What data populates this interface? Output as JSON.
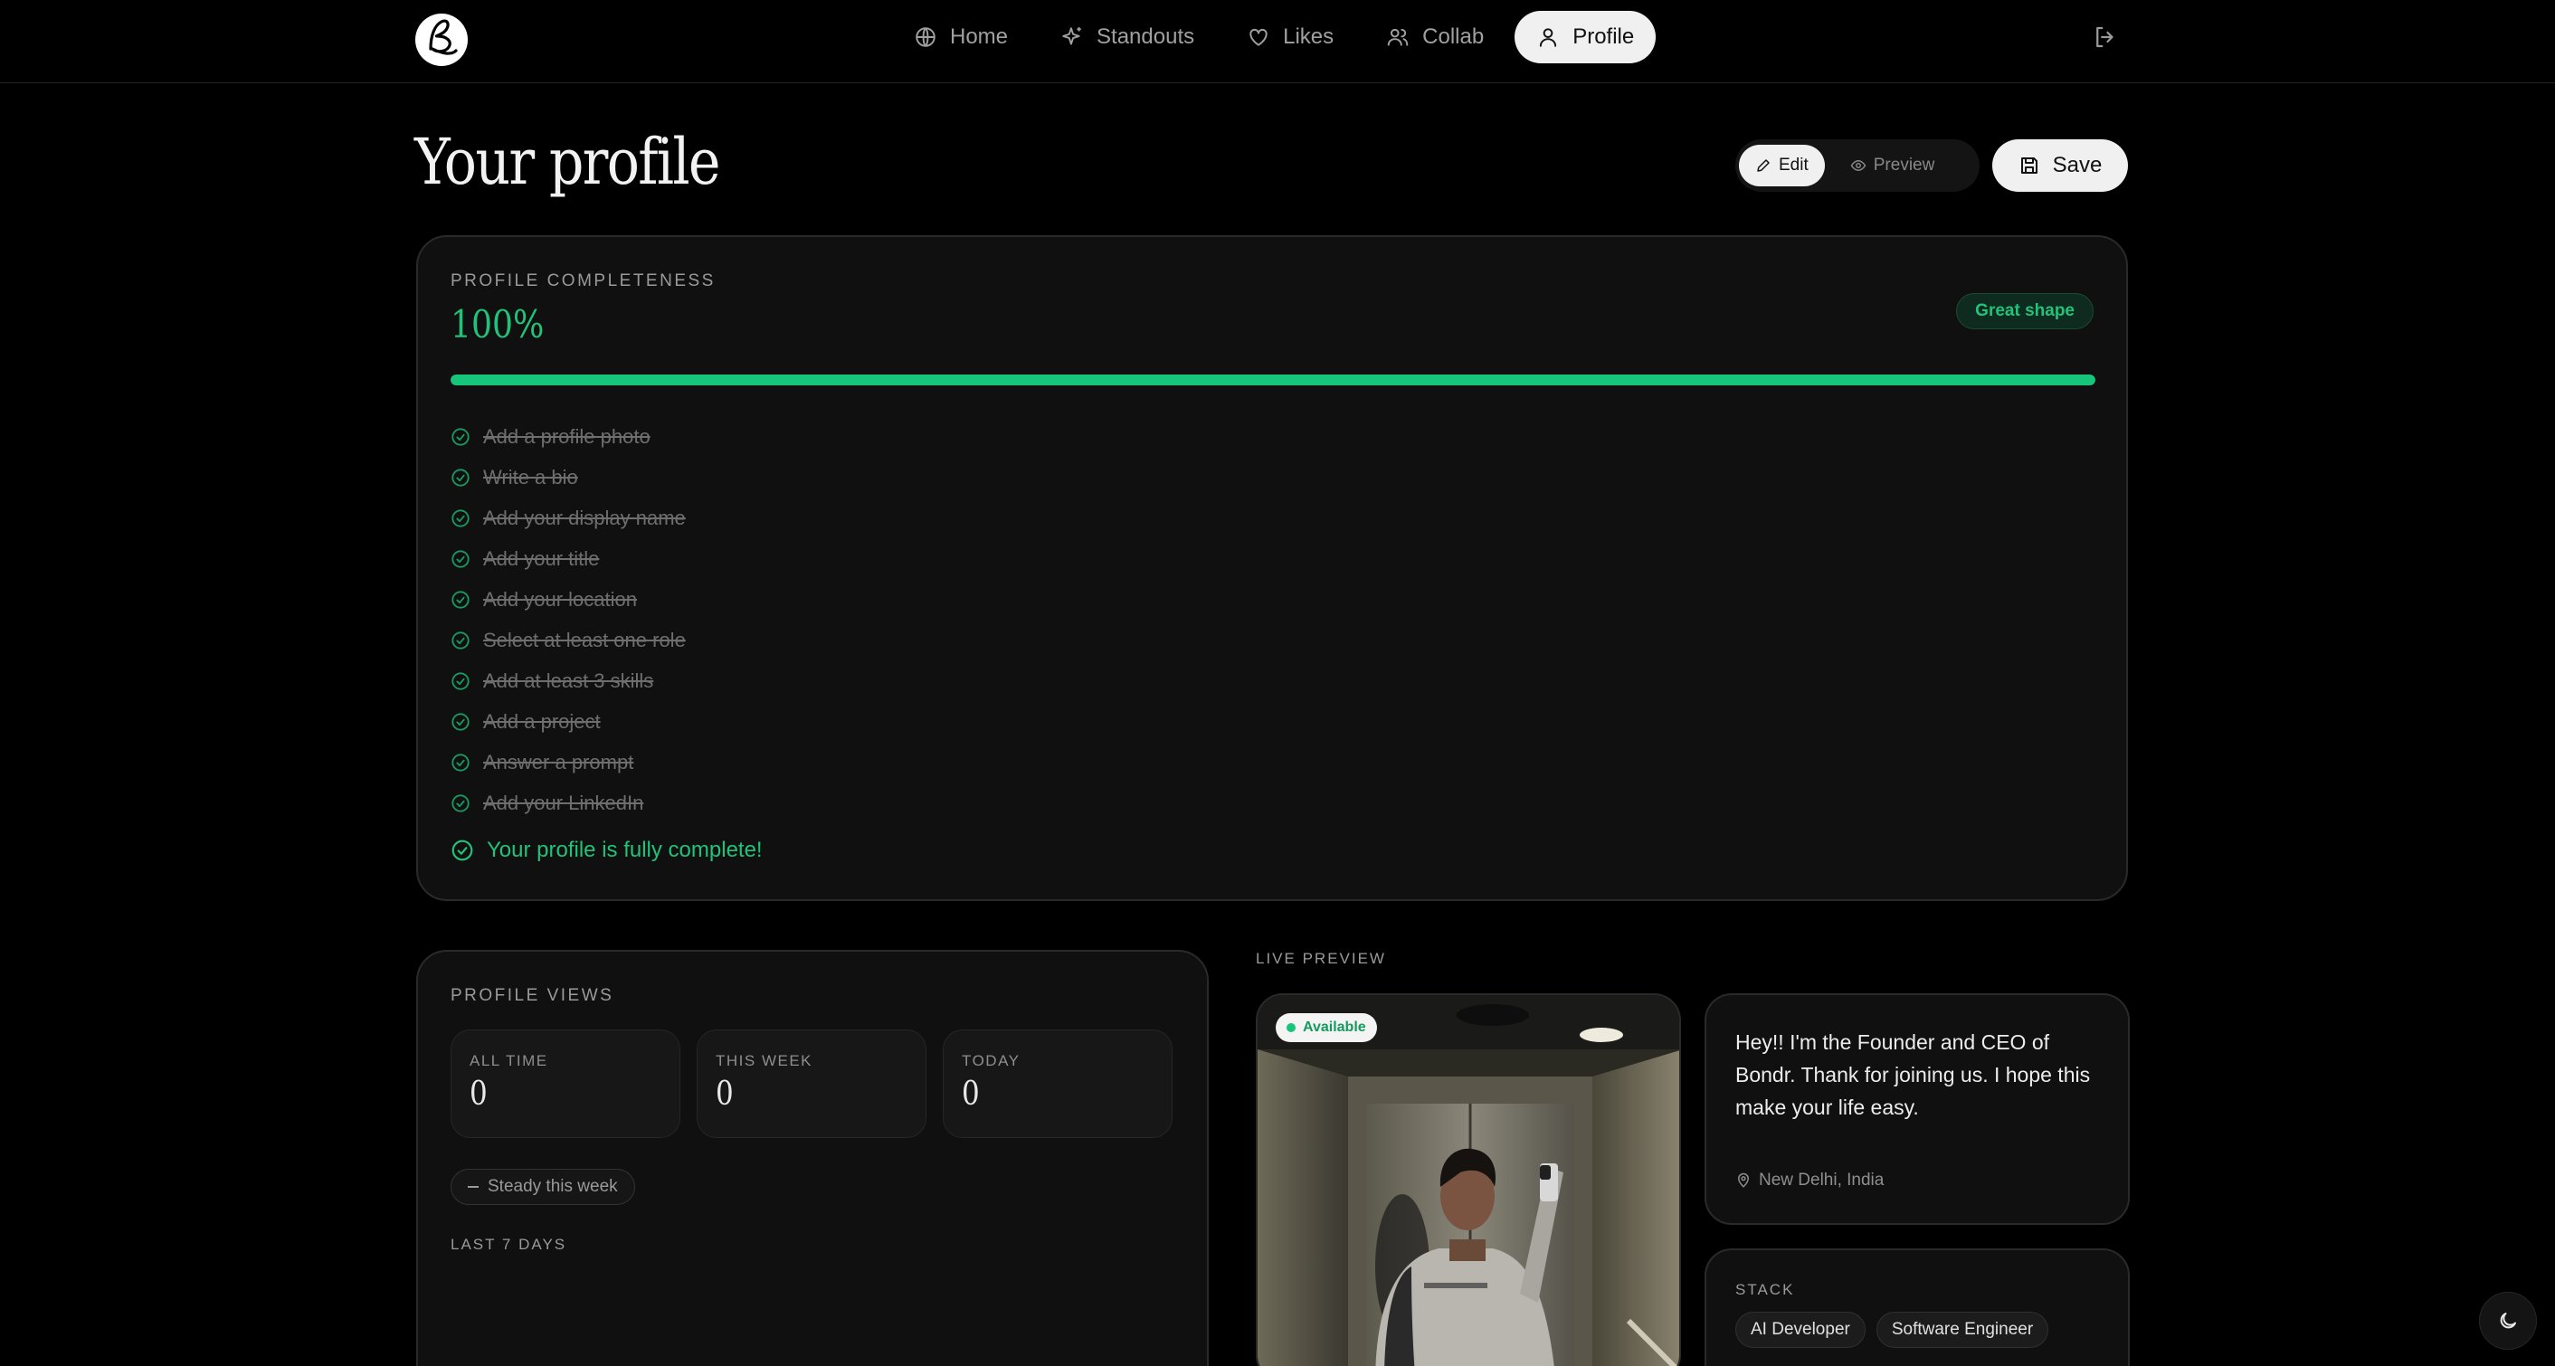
{
  "nav": {
    "items": [
      {
        "label": "Home",
        "icon": "globe-icon"
      },
      {
        "label": "Standouts",
        "icon": "sparkles-icon"
      },
      {
        "label": "Likes",
        "icon": "heart-icon"
      },
      {
        "label": "Collab",
        "icon": "users-icon"
      },
      {
        "label": "Profile",
        "icon": "user-icon",
        "active": true
      }
    ]
  },
  "header": {
    "title": "Your profile",
    "edit_label": "Edit",
    "preview_label": "Preview",
    "save_label": "Save"
  },
  "completeness": {
    "eyebrow": "PROFILE COMPLETENESS",
    "percent_text": "100%",
    "percent_value": 100,
    "badge": "Great shape",
    "items": [
      "Add a profile photo",
      "Write a bio",
      "Add your display name",
      "Add your title",
      "Add your location",
      "Select at least one role",
      "Add at least 3 skills",
      "Add a project",
      "Answer a prompt",
      "Add your LinkedIn"
    ],
    "complete_message": "Your profile is fully complete!"
  },
  "views": {
    "eyebrow": "PROFILE VIEWS",
    "stats": [
      {
        "label": "ALL TIME",
        "value": "0"
      },
      {
        "label": "THIS WEEK",
        "value": "0"
      },
      {
        "label": "TODAY",
        "value": "0"
      }
    ],
    "trend": "Steady this week",
    "last7_label": "LAST 7 DAYS"
  },
  "live_preview": {
    "label": "LIVE PREVIEW",
    "availability": "Available",
    "bio": "Hey!! I'm the Founder and CEO of Bondr. Thank for joining us. I hope this make your life easy.",
    "location": "New Delhi, India",
    "stack_label": "STACK",
    "stack": [
      "AI Developer",
      "Software Engineer"
    ]
  },
  "colors": {
    "accent_green": "#16c47a",
    "background": "#000000",
    "card": "#101010"
  }
}
